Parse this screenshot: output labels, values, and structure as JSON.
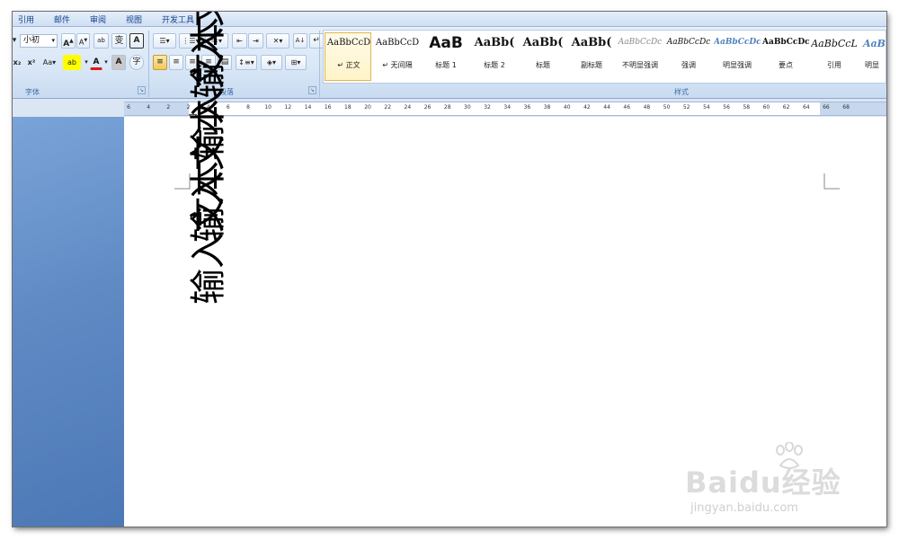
{
  "menu": {
    "tabs": [
      "引用",
      "邮件",
      "审阅",
      "视图",
      "开发工具"
    ]
  },
  "font_group": {
    "label": "字体",
    "size_value": "小初",
    "buttons": [
      "A",
      "A",
      "Aa",
      "A",
      "A"
    ]
  },
  "paragraph_group": {
    "label": "段落"
  },
  "styles_group": {
    "label": "样式",
    "cards": [
      {
        "preview": "AaBbCcD",
        "name": "↵ 正文"
      },
      {
        "preview": "AaBbCcD",
        "name": "↵ 无间隔"
      },
      {
        "preview": "AaB",
        "name": "标题 1"
      },
      {
        "preview": "AaBb(",
        "name": "标题 2"
      },
      {
        "preview": "AaBb(",
        "name": "标题"
      },
      {
        "preview": "AaBb(",
        "name": "副标题"
      },
      {
        "preview": "AaBbCcDc",
        "name": "不明显强调"
      },
      {
        "preview": "AaBbCcDc",
        "name": "强调"
      },
      {
        "preview": "AaBbCcDc",
        "name": "明显强调"
      },
      {
        "preview": "AaBbCcDc",
        "name": "要点"
      },
      {
        "preview": "AaBbCcL",
        "name": "引用"
      },
      {
        "preview": "AaB",
        "name": "明显"
      }
    ]
  },
  "ruler": {
    "ticks": [
      "6",
      "4",
      "2",
      "2",
      "4",
      "6",
      "8",
      "10",
      "12",
      "14",
      "16",
      "18",
      "20",
      "22",
      "24",
      "26",
      "28",
      "30",
      "32",
      "34",
      "36",
      "38",
      "40",
      "42",
      "44",
      "46",
      "48",
      "50",
      "52",
      "54",
      "56",
      "58",
      "60",
      "62",
      "64",
      "66",
      "68"
    ]
  },
  "document": {
    "lines": [
      "输入文本输入文本",
      "输入文本输入文本"
    ]
  },
  "watermark": {
    "brand": "Baidu经验",
    "url": "jingyan.baidu.com"
  },
  "colors": {
    "ribbon_top": "#e7f0fb",
    "ribbon_bottom": "#c9dbf1",
    "accent_text": "#15428b",
    "selected_style": "#f6c75a",
    "side_panel": "#5f8ac4"
  }
}
